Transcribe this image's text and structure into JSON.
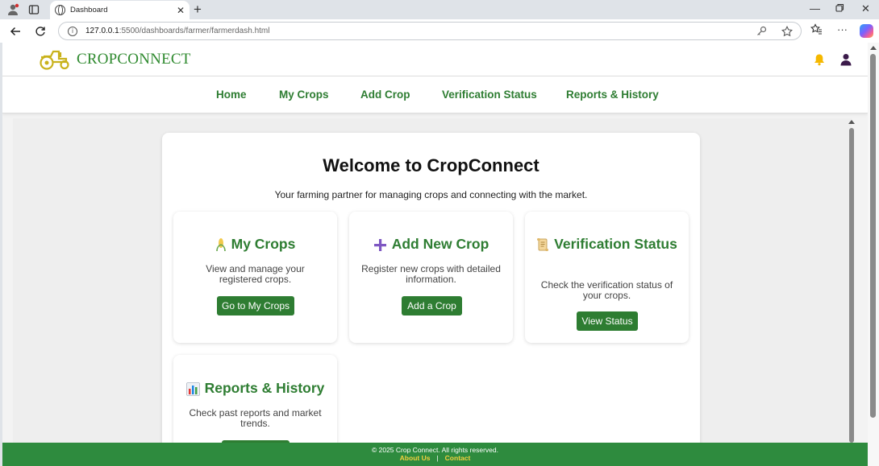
{
  "browser": {
    "tab_title": "Dashboard",
    "url_host": "127.0.0.1",
    "url_path": ":5500/dashboards/farmer/farmerdash.html"
  },
  "header": {
    "logo_text": "CROPCONNECT"
  },
  "nav": {
    "items": [
      {
        "label": "Home"
      },
      {
        "label": "My Crops"
      },
      {
        "label": "Add Crop"
      },
      {
        "label": "Verification Status"
      },
      {
        "label": "Reports & History"
      }
    ]
  },
  "main": {
    "welcome": "Welcome to CropConnect",
    "subtitle": "Your farming partner for managing crops and connecting with the market.",
    "cards": [
      {
        "icon": "corn-icon",
        "title": "My Crops",
        "desc": "View and manage your registered crops.",
        "button": "Go to My Crops"
      },
      {
        "icon": "plus-icon",
        "title": "Add New Crop",
        "desc": "Register new crops with detailed information.",
        "button": "Add a Crop"
      },
      {
        "icon": "scroll-icon",
        "title": "Verification Status",
        "desc": "Check the verification status of your crops.",
        "button": "View Status"
      },
      {
        "icon": "bar-chart-icon",
        "title": "Reports & History",
        "desc": "Check past reports and market trends.",
        "button": ""
      }
    ]
  },
  "footer": {
    "copyright": "© 2025 Crop Connect. All rights reserved.",
    "about": "About Us",
    "separator": "|",
    "contact": "Contact"
  },
  "colors": {
    "brand_green": "#2e7d32",
    "footer_green": "#2e8b3e",
    "footer_link": "#f4d03f",
    "bell": "#f5b800",
    "user": "#3b1a4a"
  }
}
